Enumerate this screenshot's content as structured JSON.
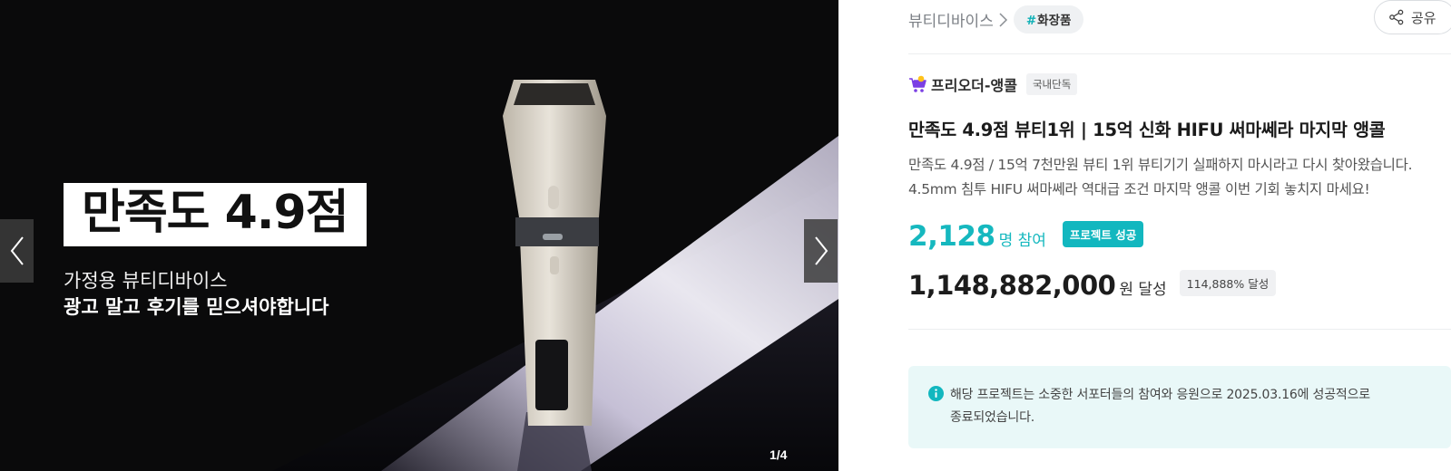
{
  "carousel": {
    "headline_badge": "만족도 4.9점",
    "subheadline": "가정용 뷰티디바이스",
    "subheadline_strong": "광고 말고 후기를 믿으셔야합니다",
    "indicator": "1/4",
    "current_index": 1,
    "total": 4
  },
  "breadcrumb": {
    "category": "뷰티디바이스",
    "tag_hash": "#",
    "tag_label": "화장품"
  },
  "share": {
    "label": "공유"
  },
  "maker": {
    "name": "프리오더-앵콜",
    "badge": "국내단독"
  },
  "project": {
    "title": "만족도 4.9점 뷰티1위 | 15억 신화 HIFU 써마쎄라 마지막 앵콜",
    "description": "만족도 4.9점 / 15억 7천만원 뷰티 1위 뷰티기기 실패하지 마시라고 다시 찾아왔습니다. 4.5mm 침투 HIFU 써마쎄라 역대급 조건 마지막 앵콜 이번 기회 놓치지 마세요!",
    "supporters_count": "2,128",
    "supporters_unit": "명 참여",
    "status_badge": "프로젝트 성공",
    "amount": "1,148,882,000",
    "amount_unit": "원 달성",
    "achievement_rate": "114,888% 달성"
  },
  "notice": {
    "text": "해당 프로젝트는 소중한 서포터들의 참여와 응원으로 2025.03.16에 성공적으로 종료되었습니다."
  },
  "colors": {
    "accent": "#16b8bf",
    "notice_bg": "#e9f8f8",
    "hero_bg": "#0a0a0b"
  },
  "icons": {
    "prev": "chevron-left-icon",
    "next": "chevron-right-icon",
    "share": "share-icon",
    "maker": "cart-icon",
    "notice": "info-icon",
    "breadcrumb_sep": "chevron-right-icon"
  }
}
